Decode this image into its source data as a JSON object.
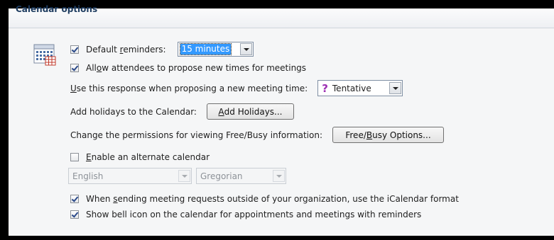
{
  "section": {
    "title": "Calendar options"
  },
  "default_reminders": {
    "checked": true,
    "label_pre": "Default ",
    "label_key": "r",
    "label_post": "eminders:",
    "value": "15 minutes"
  },
  "allow_propose": {
    "checked": true,
    "label_pre": "All",
    "label_key": "o",
    "label_post": "w attendees to propose new times for meetings"
  },
  "response": {
    "label_key": "U",
    "label_post": "se this response when proposing a new meeting time:",
    "value": "Tentative",
    "icon": "question-mark-icon"
  },
  "holidays": {
    "label": "Add holidays to the Calendar:",
    "button_key": "A",
    "button_post": "dd Holidays..."
  },
  "permissions": {
    "label": "Change the permissions for viewing Free/Busy information:",
    "button_pre": "Free/",
    "button_key": "B",
    "button_post": "usy Options..."
  },
  "alternate": {
    "checked": false,
    "label_key": "E",
    "label_post": "nable an alternate calendar",
    "language": "English",
    "calendar": "Gregorian"
  },
  "icalendar": {
    "checked": true,
    "label_pre": "When ",
    "label_key": "s",
    "label_post": "ending meeting requests outside of your organization, use the iCalendar format"
  },
  "bell": {
    "checked": true,
    "label": "Show bell icon on the calendar for appointments and meetings with reminders"
  }
}
